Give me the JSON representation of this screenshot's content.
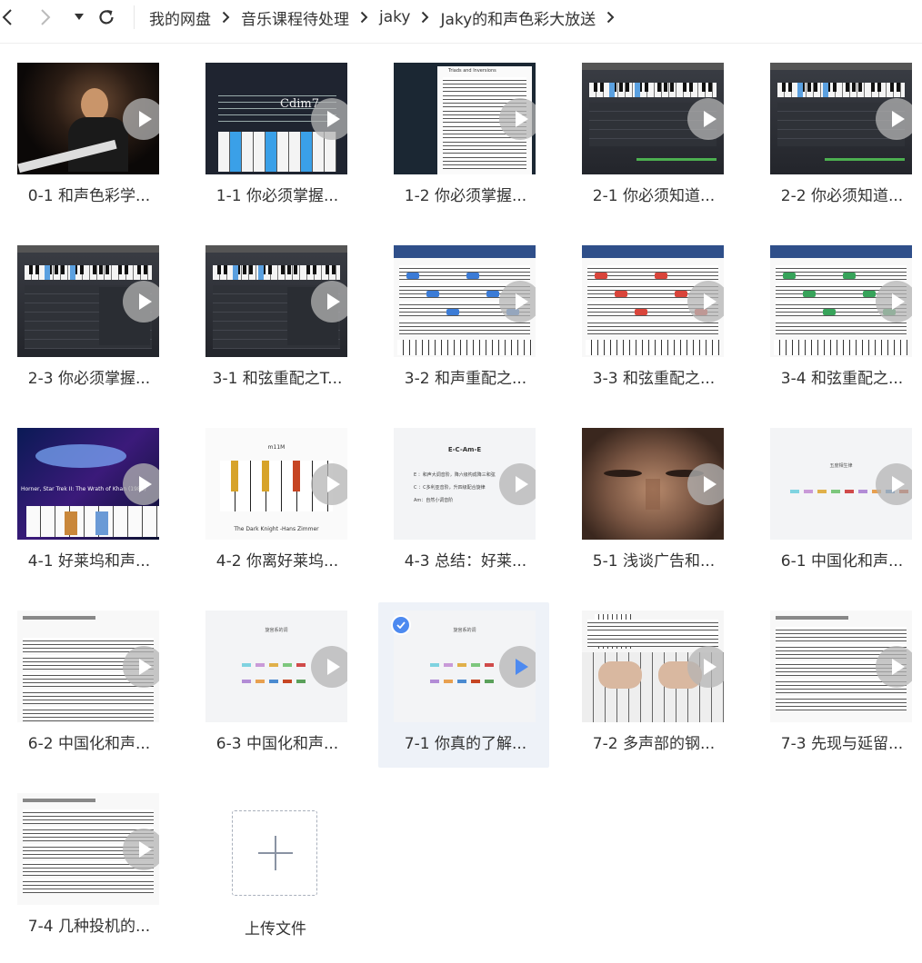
{
  "breadcrumb": [
    "我的网盘",
    "音乐课程待处理",
    "jaky",
    "Jaky的和声色彩大放送"
  ],
  "files": [
    {
      "name": "0-1 和声色彩学...",
      "thumb": "person-piano"
    },
    {
      "name": "1-1 你必须掌握...",
      "thumb": "keyboard-cdim7"
    },
    {
      "name": "1-2 你必须掌握...",
      "thumb": "score-app"
    },
    {
      "name": "2-1 你必须知道...",
      "thumb": "daw-keyboard"
    },
    {
      "name": "2-2 你必须知道...",
      "thumb": "daw-keyboard"
    },
    {
      "name": "2-3 你必须掌握...",
      "thumb": "daw-keyboard-2"
    },
    {
      "name": "3-1 和弦重配之T...",
      "thumb": "daw-keyboard-2"
    },
    {
      "name": "3-2 和声重配之...",
      "thumb": "score-keyboard"
    },
    {
      "name": "3-3 和弦重配之...",
      "thumb": "score-keyboard-red"
    },
    {
      "name": "3-4 和弦重配之...",
      "thumb": "score-keyboard-green"
    },
    {
      "name": "4-1 好莱坞和声...",
      "thumb": "space-keyboard"
    },
    {
      "name": "4-2 你离好莱坞...",
      "thumb": "piano-colored"
    },
    {
      "name": "4-3 总结：好莱...",
      "thumb": "text-slide"
    },
    {
      "name": "5-1 浅谈广告和...",
      "thumb": "face-closeup"
    },
    {
      "name": "6-1 中国化和声...",
      "thumb": "swatch-slide"
    },
    {
      "name": "6-2 中国化和声...",
      "thumb": "score-page"
    },
    {
      "name": "6-3 中国化和声...",
      "thumb": "swatch-slide-2"
    },
    {
      "name": "7-1 你真的了解...",
      "thumb": "swatch-slide-2",
      "selected": true
    },
    {
      "name": "7-2 多声部的钢...",
      "thumb": "piano-hands"
    },
    {
      "name": "7-3 先现与延留...",
      "thumb": "score-page-2"
    },
    {
      "name": "7-4 几种投机的...",
      "thumb": "score-page-2"
    }
  ],
  "thumb_text": {
    "cdim7": "Cdim7",
    "score_title": "Triads and Inversions",
    "mood_title": "m11M",
    "credit": "The Dark Knight -Hans Zimmer",
    "space_caption": "Horner, Star Trek II: The Wrath of Khan (1982)",
    "slide_title": "E-C-Am-E",
    "slide_lines": [
      "E ：和声大调音阶，降六级构成降三和弦",
      "C ：C多利亚音阶，升四级配合旋律",
      "Am：自然小调音阶"
    ],
    "swatch_title": "五度相生律",
    "swatch_title_2": "旋宫系的调"
  },
  "upload": {
    "label": "上传文件"
  },
  "icons": {
    "back": "chevron-left-icon",
    "forward": "chevron-right-icon",
    "history": "caret-down-icon",
    "refresh": "refresh-icon",
    "play": "play-icon",
    "check": "check-icon",
    "add": "plus-icon"
  },
  "colors": {
    "accent": "#4d8af0",
    "selected_bg": "#eef2f8",
    "play_active": "#4d8af0"
  }
}
